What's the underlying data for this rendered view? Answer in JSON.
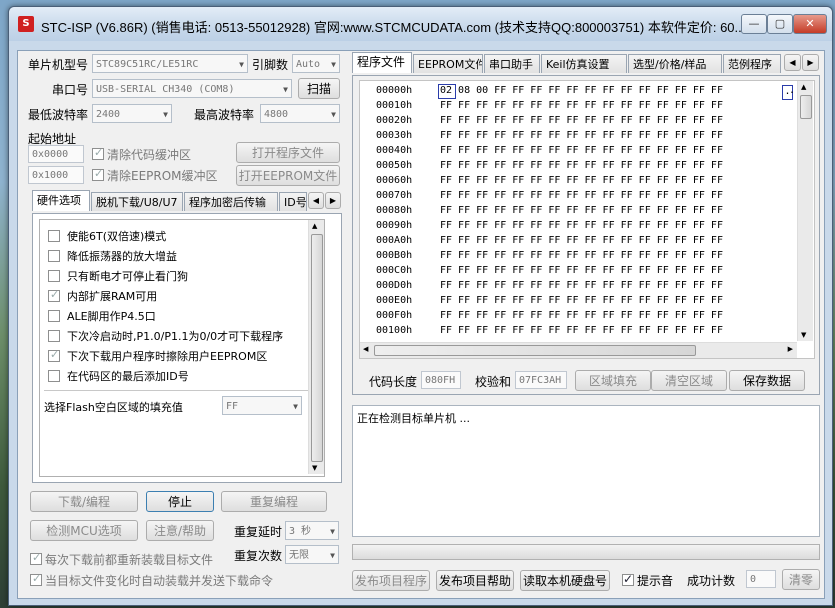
{
  "window": {
    "title": "STC-ISP (V6.86R) (销售电话: 0513-55012928) 官网:www.STCMCUDATA.com  (技术支持QQ:800003751) 本软件定价: 60...",
    "icon_label": "S"
  },
  "left": {
    "mcu_label": "单片机型号",
    "mcu_value": "STC89C51RC/LE51RC",
    "pin_label": "引脚数",
    "pin_value": "Auto",
    "port_label": "串口号",
    "port_value": "USB-SERIAL CH340 (COM8)",
    "scan_btn": "扫描",
    "min_baud_label": "最低波特率",
    "min_baud_value": "2400",
    "max_baud_label": "最高波特率",
    "max_baud_value": "4800",
    "start_addr_label": "起始地址",
    "addr1": "0x0000",
    "clear_code_label": "清除代码缓冲区",
    "open_prog_btn": "打开程序文件",
    "addr2": "0x1000",
    "clear_eeprom_label": "清除EEPROM缓冲区",
    "open_eeprom_btn": "打开EEPROM文件",
    "tabs": [
      "硬件选项",
      "脱机下载/U8/U7",
      "程序加密后传输",
      "ID号"
    ],
    "options": [
      {
        "label": "使能6T(双倍速)模式",
        "checked": false
      },
      {
        "label": "降低振荡器的放大增益",
        "checked": false
      },
      {
        "label": "只有断电才可停止看门狗",
        "checked": false
      },
      {
        "label": "内部扩展RAM可用",
        "checked": true
      },
      {
        "label": "ALE脚用作P4.5口",
        "checked": false
      },
      {
        "label": "下次冷启动时,P1.0/P1.1为0/0才可下载程序",
        "checked": false
      },
      {
        "label": "下次下载用户程序时擦除用户EEPROM区",
        "checked": true
      },
      {
        "label": "在代码区的最后添加ID号",
        "checked": false
      }
    ],
    "fill_label": "选择Flash空白区域的填充值",
    "fill_value": "FF",
    "download_btn": "下载/编程",
    "stop_btn": "停止",
    "reprogram_btn": "重复编程",
    "detect_btn": "检测MCU选项",
    "help_btn": "注意/帮助",
    "repeat_delay_label": "重复延时",
    "repeat_delay_value": "3 秒",
    "repeat_count_label": "重复次数",
    "repeat_count_value": "无限",
    "reload_label": "每次下载前都重新装载目标文件",
    "autoload_label": "当目标文件变化时自动装载并发送下载命令"
  },
  "right": {
    "tabs": [
      "程序文件",
      "EEPROM文件",
      "串口助手",
      "Keil仿真设置",
      "选型/价格/样品",
      "范例程序"
    ],
    "hex_addresses": [
      "00000h",
      "00010h",
      "00020h",
      "00030h",
      "00040h",
      "00050h",
      "00060h",
      "00070h",
      "00080h",
      "00090h",
      "000A0h",
      "000B0h",
      "000C0h",
      "000D0h",
      "000E0h",
      "000F0h",
      "00100h"
    ],
    "hex_first_row": "02 08 00 FF FF FF FF FF FF FF FF FF FF FF FF FF",
    "hex_fill_row": "FF FF FF FF FF FF FF FF FF FF FF FF FF FF FF FF",
    "ascii_first": ".",
    "code_len_label": "代码长度",
    "code_len_value": "080FH",
    "checksum_label": "校验和",
    "checksum_value": "07FC3AH",
    "fill_area_btn": "区域填充",
    "clear_area_btn": "清空区域",
    "save_btn": "保存数据",
    "log_text": "正在检测目标单片机 ...",
    "publish_btn": "发布项目程序",
    "publish_help_btn": "发布项目帮助",
    "read_disk_btn": "读取本机硬盘号",
    "sound_label": "提示音",
    "success_label": "成功计数",
    "success_value": "0",
    "clear_btn": "清零"
  }
}
